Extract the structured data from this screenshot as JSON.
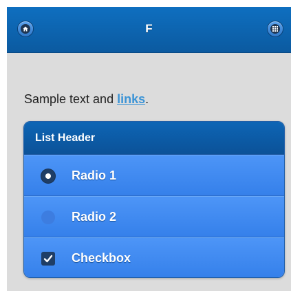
{
  "header": {
    "title": "F",
    "left_icon": "home-icon",
    "right_icon": "grid-icon"
  },
  "content": {
    "text_before": "Sample text and ",
    "link_text": "links",
    "text_after": "."
  },
  "list": {
    "header": "List Header",
    "items": [
      {
        "type": "radio",
        "label": "Radio 1",
        "checked": true
      },
      {
        "type": "radio",
        "label": "Radio 2",
        "checked": false
      },
      {
        "type": "checkbox",
        "label": "Checkbox",
        "checked": true
      }
    ]
  },
  "colors": {
    "header_bar": "#0e6fc0",
    "list_item": "#4d95f7",
    "link": "#3a93d6",
    "background": "#dcdcdc"
  }
}
